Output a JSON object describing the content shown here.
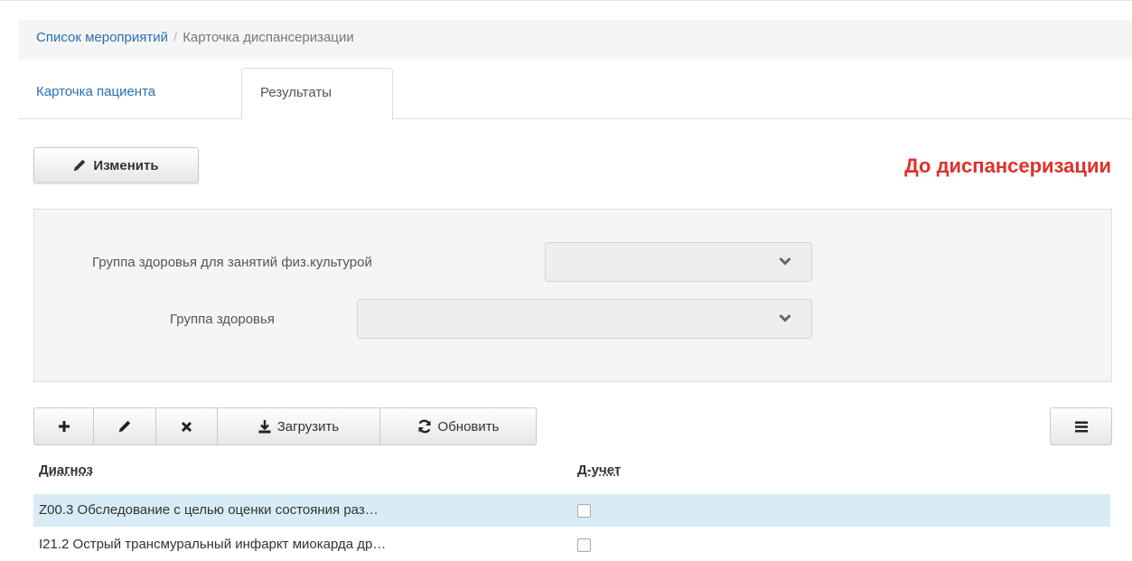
{
  "breadcrumb": {
    "link": "Список мероприятий",
    "separator": "/",
    "current": "Карточка диспансеризации"
  },
  "tabs": [
    {
      "label": "Карточка пациента",
      "active": false
    },
    {
      "label": "Результаты",
      "active": true
    }
  ],
  "toolbar": {
    "edit_label": "Изменить",
    "edit_icon": "pencil-icon"
  },
  "status": {
    "text": "До диспансеризации",
    "color": "#e0302a"
  },
  "form": {
    "fields": [
      {
        "label": "Группа здоровья для занятий физ.культурой",
        "value": ""
      },
      {
        "label": "Группа здоровья",
        "value": ""
      }
    ]
  },
  "grid_toolbar": {
    "add_icon": "plus-icon",
    "edit_icon": "pencil-icon",
    "delete_icon": "times-icon",
    "load_label": "Загрузить",
    "load_icon": "download-icon",
    "refresh_label": "Обновить",
    "refresh_icon": "refresh-icon",
    "menu_icon": "list-icon"
  },
  "table": {
    "columns": [
      "Диагноз",
      "Д-учет"
    ],
    "rows": [
      {
        "diagnosis": "Z00.3 Обследование с целью оценки состояния раз…",
        "d_uchet": false,
        "selected": true
      },
      {
        "diagnosis": "I21.2 Острый трансмуральный инфаркт миокарда др…",
        "d_uchet": false,
        "selected": false
      }
    ]
  },
  "colors": {
    "link": "#2a6fb3",
    "selected_row": "#d9ecf5",
    "panel": "#f5f5f5"
  }
}
